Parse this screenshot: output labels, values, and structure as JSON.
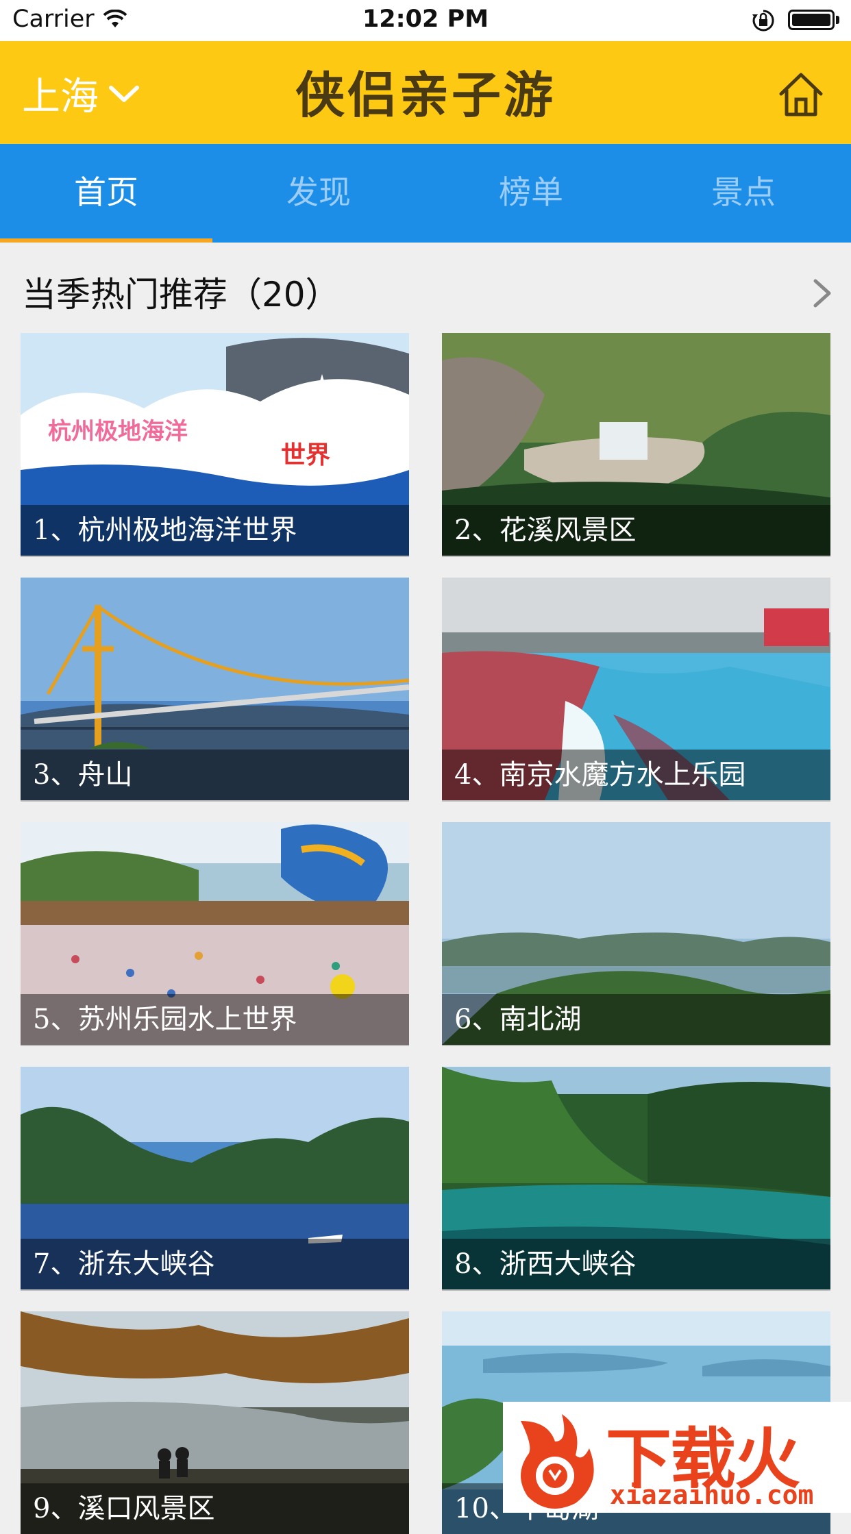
{
  "status_bar": {
    "carrier": "Carrier",
    "time": "12:02 PM"
  },
  "header": {
    "city": "上海",
    "title": "侠侣亲子游"
  },
  "tabs": [
    {
      "label": "首页",
      "active": true
    },
    {
      "label": "发现",
      "active": false
    },
    {
      "label": "榜单",
      "active": false
    },
    {
      "label": "景点",
      "active": false
    }
  ],
  "section": {
    "title": "当季热门推荐（20）"
  },
  "cards": [
    {
      "label": "1、杭州极地海洋世界",
      "scene": "ocean-park"
    },
    {
      "label": "2、花溪风景区",
      "scene": "waterfall"
    },
    {
      "label": "3、舟山",
      "scene": "bridge"
    },
    {
      "label": "4、南京水魔方水上乐园",
      "scene": "wave-pool"
    },
    {
      "label": "5、苏州乐园水上世界",
      "scene": "water-park"
    },
    {
      "label": "6、南北湖",
      "scene": "lake-view"
    },
    {
      "label": "7、浙东大峡谷",
      "scene": "mountain-lake"
    },
    {
      "label": "8、浙西大峡谷",
      "scene": "green-gorge"
    },
    {
      "label": "9、溪口风景区",
      "scene": "river-trees"
    },
    {
      "label": "10、千岛湖",
      "scene": "islands-lake"
    }
  ],
  "watermark": {
    "brand": "下载火",
    "domain": "xiazaihuo.com"
  },
  "colors": {
    "header": "#fdc913",
    "tabbar": "#1c8ee8",
    "tab_indicator": "#f5a623",
    "background": "#efefef"
  }
}
